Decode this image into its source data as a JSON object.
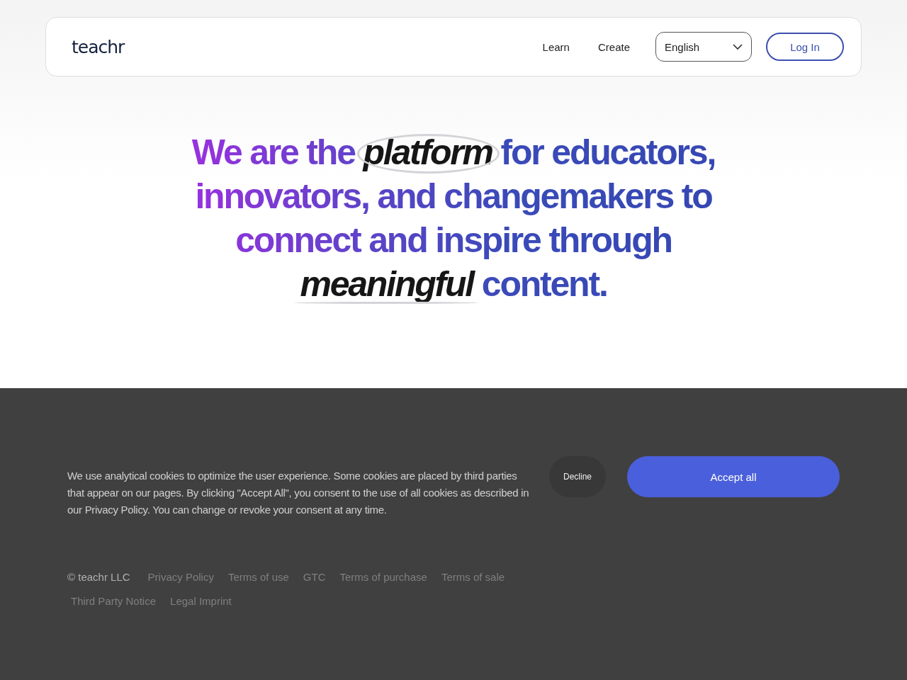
{
  "header": {
    "logo": "teachr",
    "nav": [
      "Learn",
      "Create"
    ],
    "language": {
      "value": "English"
    },
    "login": "Log In"
  },
  "hero": {
    "segments": [
      {
        "text": "We are the ",
        "kind": "plain"
      },
      {
        "text": "platform",
        "kind": "circled"
      },
      {
        "text": " for educators, innovators, and changemakers to connect and inspire through ",
        "kind": "plain"
      },
      {
        "text": "meaningful",
        "kind": "underlined"
      },
      {
        "text": " content.",
        "kind": "plain"
      }
    ]
  },
  "cookie_banner": {
    "message": "We use analytical cookies to optimize the user experience. Some cookies are placed by third parties that appear on our pages. By clicking \"Accept All\", you consent to the use of all cookies as described in our Privacy Policy. You can change or revoke your consent at any time.",
    "decline": "Decline",
    "accept": "Accept all"
  },
  "footer": {
    "copyright": "© teachr LLC",
    "links": [
      "Privacy Policy",
      "Terms of use",
      "GTC",
      "Terms of purchase",
      "Terms of sale",
      "Third Party Notice",
      "Legal Imprint"
    ]
  }
}
